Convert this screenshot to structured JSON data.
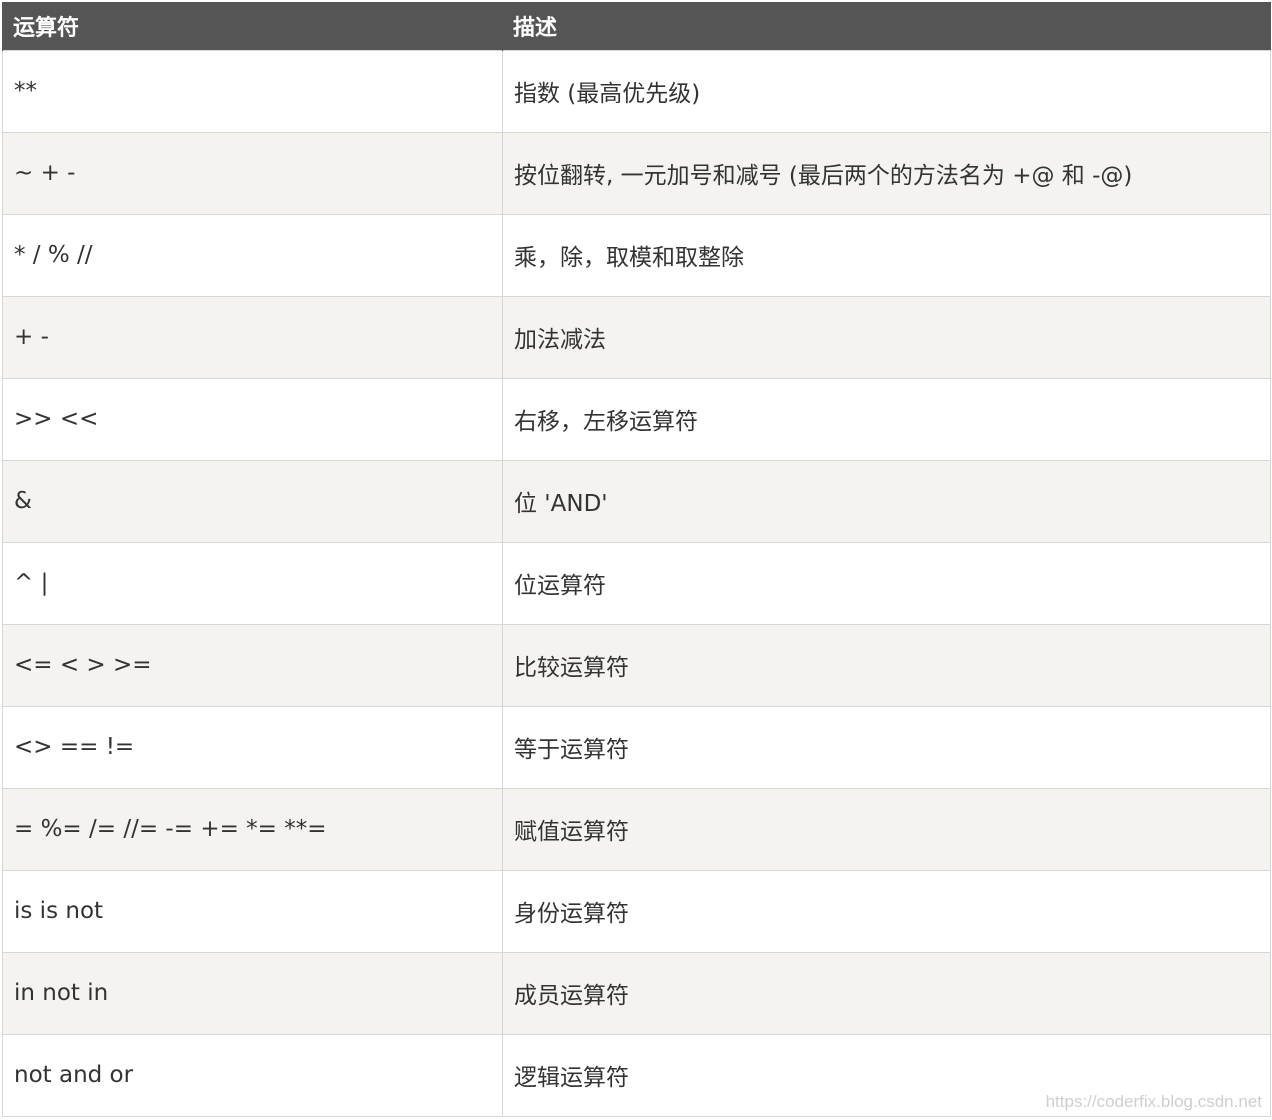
{
  "table": {
    "headers": [
      "运算符",
      "描述"
    ],
    "rows": [
      {
        "op": "**",
        "desc": "指数 (最高优先级)"
      },
      {
        "op": "~ + -",
        "desc": "按位翻转, 一元加号和减号 (最后两个的方法名为 +@ 和 -@)"
      },
      {
        "op": "* / % //",
        "desc": "乘，除，取模和取整除"
      },
      {
        "op": "+ -",
        "desc": "加法减法"
      },
      {
        "op": ">> <<",
        "desc": "右移，左移运算符"
      },
      {
        "op": "&",
        "desc": "位 'AND'"
      },
      {
        "op": "^ |",
        "desc": "位运算符"
      },
      {
        "op": "<= < > >=",
        "desc": "比较运算符"
      },
      {
        "op": "<> == !=",
        "desc": "等于运算符"
      },
      {
        "op": "= %= /= //= -= += *= **=",
        "desc": "赋值运算符"
      },
      {
        "op": "is is not",
        "desc": "身份运算符"
      },
      {
        "op": "in not in",
        "desc": "成员运算符"
      },
      {
        "op": "not and or",
        "desc": "逻辑运算符"
      }
    ]
  },
  "watermark": "https://coderfix.blog.csdn.net",
  "colors": {
    "header_bg": "#555555",
    "header_text": "#ffffff",
    "row_alt_bg": "#f4f3f0",
    "border": "#d6d6d6"
  }
}
